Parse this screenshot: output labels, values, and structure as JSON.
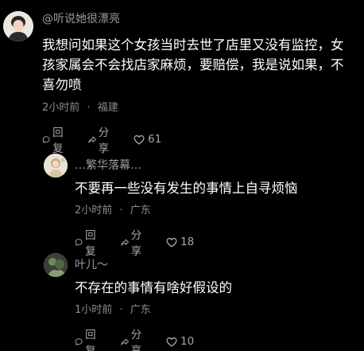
{
  "comments": [
    {
      "username": "@听说她很漂亮",
      "lines": [
        "我想问如果这个女孩当时去世了店里又没有监控，女",
        "孩家属会不会找店家麻烦，要赔偿，我是说如果，不",
        "喜勿喷"
      ],
      "time": "2小时前",
      "location": "福建",
      "reply_label": "回复",
      "share_label": "分享",
      "likes": "61"
    },
    {
      "username": "…繁华落幕…",
      "lines": [
        "不要再一些没有发生的事情上自寻烦恼"
      ],
      "time": "2小时前",
      "location": "广东",
      "reply_label": "回复",
      "share_label": "分享",
      "likes": "18"
    },
    {
      "username": "叶儿～",
      "lines": [
        "不存在的事情有啥好假设的"
      ],
      "time": "1小时前",
      "location": "广东",
      "reply_label": "回复",
      "share_label": "分享",
      "likes": "10"
    }
  ],
  "meta_separator": "·",
  "icons": {
    "reply": "comment-bubble-icon",
    "share": "share-arrow-icon",
    "like": "heart-outline-icon"
  },
  "colors": {
    "background": "#000000",
    "text": "#ffffff",
    "muted": "#8c8c8c"
  }
}
